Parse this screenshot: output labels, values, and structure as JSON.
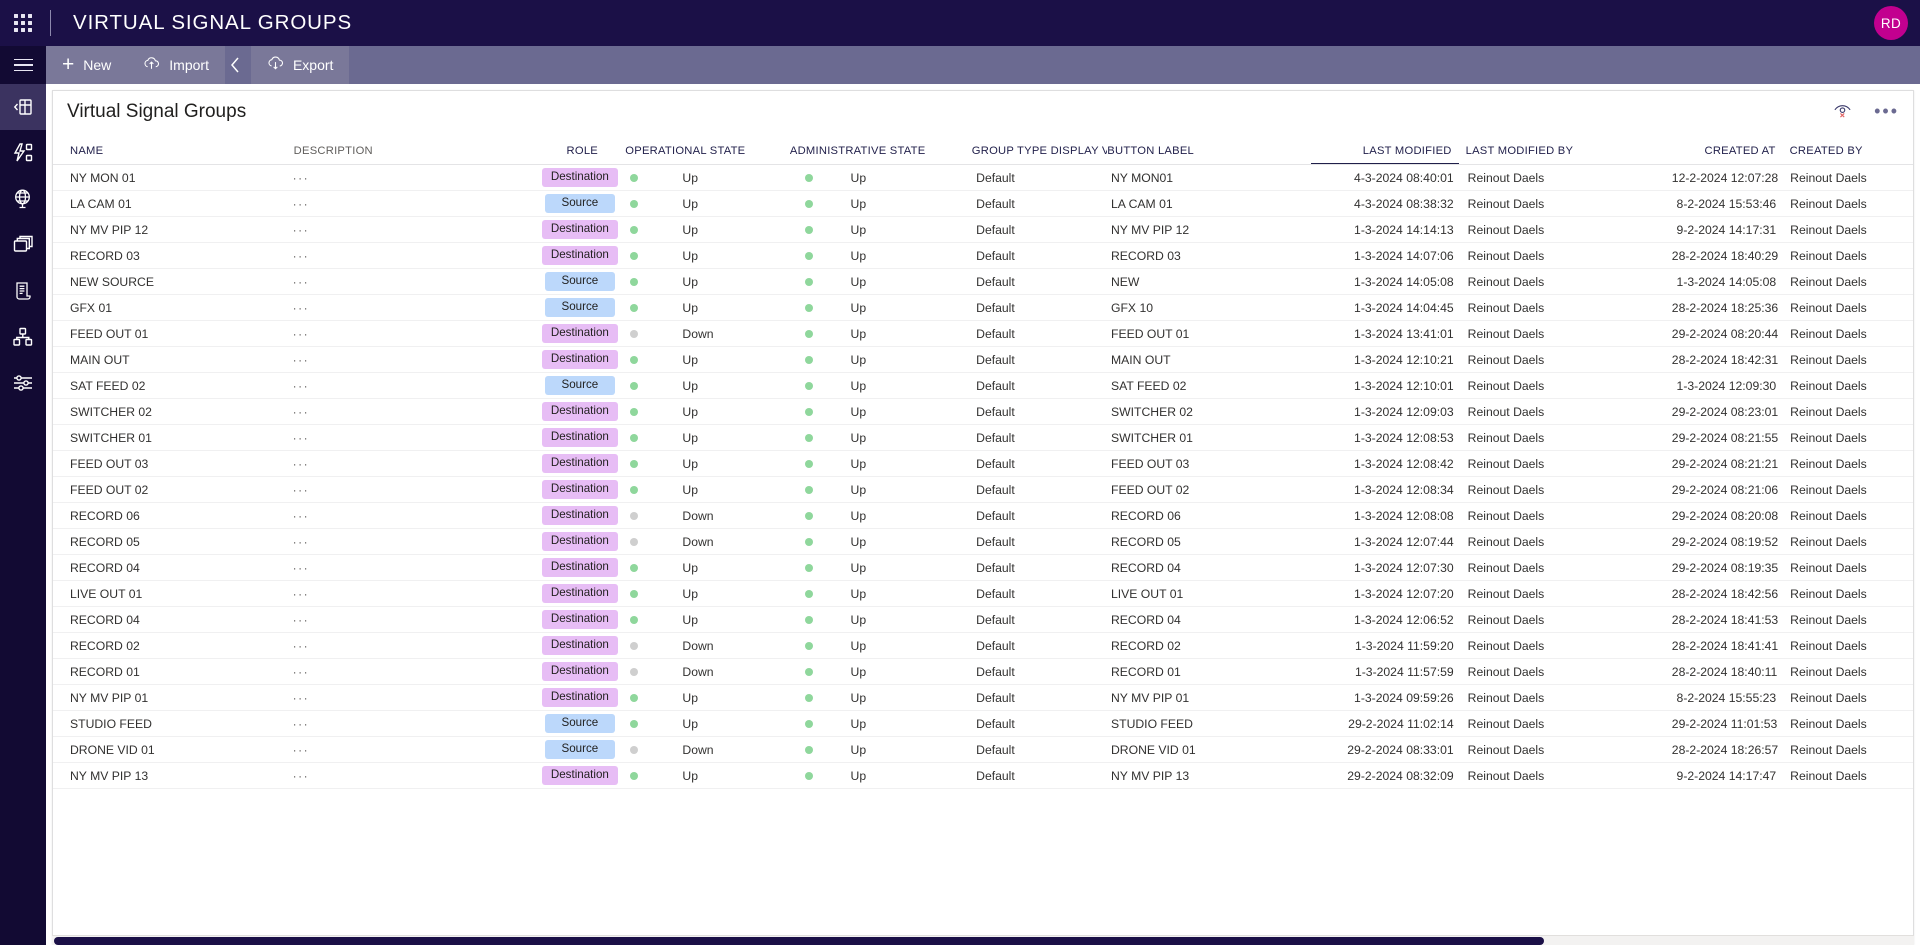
{
  "topbar": {
    "waffle_icon": "app-launcher-icon",
    "title": "VIRTUAL SIGNAL GROUPS",
    "avatar_initials": "RD",
    "avatar_color": "#c2008f",
    "background": "#1b1047"
  },
  "commandbar": {
    "background": "#6b6a91",
    "hamburger_icon": "hamburger-icon",
    "items": [
      {
        "label": "New",
        "icon": "plus-icon"
      },
      {
        "label": "Import",
        "icon": "cloud-upload-icon"
      },
      {
        "label": "Export",
        "icon": "cloud-download-icon"
      }
    ],
    "chevron_icon": "chevron-left-icon"
  },
  "rail": {
    "background": "#120a33",
    "items": [
      {
        "name": "collapse-panel-icon",
        "active": true
      },
      {
        "name": "signal-flow-icon",
        "active": false
      },
      {
        "name": "globe-network-icon",
        "active": false
      },
      {
        "name": "copy-layers-icon",
        "active": false
      },
      {
        "name": "script-document-icon",
        "active": false
      },
      {
        "name": "node-graph-icon",
        "active": false
      },
      {
        "name": "sliders-settings-icon",
        "active": false
      }
    ]
  },
  "panel": {
    "title": "Virtual Signal Groups",
    "hide_icon": "eye-hidden-icon",
    "more_icon": "more-options-icon"
  },
  "grid": {
    "sorted_column": "LAST MODIFIED",
    "sort_direction": "descending",
    "columns": [
      "NAME",
      "DESCRIPTION",
      "ROLE",
      "OPERATIONAL STATE",
      "ADMINISTRATIVE STATE",
      "GROUP TYPE DISPLAY VALUE",
      "BUTTON LABEL",
      "LAST MODIFIED",
      "LAST MODIFIED BY",
      "CREATED AT",
      "CREATED BY"
    ],
    "description_placeholder": "···",
    "rows": [
      {
        "name": "NY MON 01",
        "role": "Destination",
        "op": "Up",
        "admin": "Up",
        "group_type": "Default",
        "button_label": "NY MON01",
        "last_modified": "4-3-2024 08:40:01",
        "last_modified_by": "Reinout Daels",
        "created_at": "12-2-2024 12:07:28",
        "created_by": "Reinout Daels"
      },
      {
        "name": "LA CAM 01",
        "role": "Source",
        "op": "Up",
        "admin": "Up",
        "group_type": "Default",
        "button_label": "LA CAM 01",
        "last_modified": "4-3-2024 08:38:32",
        "last_modified_by": "Reinout Daels",
        "created_at": "8-2-2024 15:53:46",
        "created_by": "Reinout Daels"
      },
      {
        "name": "NY MV PIP 12",
        "role": "Destination",
        "op": "Up",
        "admin": "Up",
        "group_type": "Default",
        "button_label": "NY MV PIP 12",
        "last_modified": "1-3-2024 14:14:13",
        "last_modified_by": "Reinout Daels",
        "created_at": "9-2-2024 14:17:31",
        "created_by": "Reinout Daels"
      },
      {
        "name": "RECORD 03",
        "role": "Destination",
        "op": "Up",
        "admin": "Up",
        "group_type": "Default",
        "button_label": "RECORD 03",
        "last_modified": "1-3-2024 14:07:06",
        "last_modified_by": "Reinout Daels",
        "created_at": "28-2-2024 18:40:29",
        "created_by": "Reinout Daels"
      },
      {
        "name": "NEW SOURCE",
        "role": "Source",
        "op": "Up",
        "admin": "Up",
        "group_type": "Default",
        "button_label": "NEW",
        "last_modified": "1-3-2024 14:05:08",
        "last_modified_by": "Reinout Daels",
        "created_at": "1-3-2024 14:05:08",
        "created_by": "Reinout Daels"
      },
      {
        "name": "GFX 01",
        "role": "Source",
        "op": "Up",
        "admin": "Up",
        "group_type": "Default",
        "button_label": "GFX 10",
        "last_modified": "1-3-2024 14:04:45",
        "last_modified_by": "Reinout Daels",
        "created_at": "28-2-2024 18:25:36",
        "created_by": "Reinout Daels"
      },
      {
        "name": "FEED OUT 01",
        "role": "Destination",
        "op": "Down",
        "admin": "Up",
        "group_type": "Default",
        "button_label": "FEED OUT 01",
        "last_modified": "1-3-2024 13:41:01",
        "last_modified_by": "Reinout Daels",
        "created_at": "29-2-2024 08:20:44",
        "created_by": "Reinout Daels"
      },
      {
        "name": "MAIN OUT",
        "role": "Destination",
        "op": "Up",
        "admin": "Up",
        "group_type": "Default",
        "button_label": "MAIN OUT",
        "last_modified": "1-3-2024 12:10:21",
        "last_modified_by": "Reinout Daels",
        "created_at": "28-2-2024 18:42:31",
        "created_by": "Reinout Daels"
      },
      {
        "name": "SAT FEED 02",
        "role": "Source",
        "op": "Up",
        "admin": "Up",
        "group_type": "Default",
        "button_label": "SAT FEED 02",
        "last_modified": "1-3-2024 12:10:01",
        "last_modified_by": "Reinout Daels",
        "created_at": "1-3-2024 12:09:30",
        "created_by": "Reinout Daels"
      },
      {
        "name": "SWITCHER 02",
        "role": "Destination",
        "op": "Up",
        "admin": "Up",
        "group_type": "Default",
        "button_label": "SWITCHER 02",
        "last_modified": "1-3-2024 12:09:03",
        "last_modified_by": "Reinout Daels",
        "created_at": "29-2-2024 08:23:01",
        "created_by": "Reinout Daels"
      },
      {
        "name": "SWITCHER 01",
        "role": "Destination",
        "op": "Up",
        "admin": "Up",
        "group_type": "Default",
        "button_label": "SWITCHER 01",
        "last_modified": "1-3-2024 12:08:53",
        "last_modified_by": "Reinout Daels",
        "created_at": "29-2-2024 08:21:55",
        "created_by": "Reinout Daels"
      },
      {
        "name": "FEED OUT 03",
        "role": "Destination",
        "op": "Up",
        "admin": "Up",
        "group_type": "Default",
        "button_label": "FEED OUT 03",
        "last_modified": "1-3-2024 12:08:42",
        "last_modified_by": "Reinout Daels",
        "created_at": "29-2-2024 08:21:21",
        "created_by": "Reinout Daels"
      },
      {
        "name": "FEED OUT 02",
        "role": "Destination",
        "op": "Up",
        "admin": "Up",
        "group_type": "Default",
        "button_label": "FEED OUT 02",
        "last_modified": "1-3-2024 12:08:34",
        "last_modified_by": "Reinout Daels",
        "created_at": "29-2-2024 08:21:06",
        "created_by": "Reinout Daels"
      },
      {
        "name": "RECORD 06",
        "role": "Destination",
        "op": "Down",
        "admin": "Up",
        "group_type": "Default",
        "button_label": "RECORD 06",
        "last_modified": "1-3-2024 12:08:08",
        "last_modified_by": "Reinout Daels",
        "created_at": "29-2-2024 08:20:08",
        "created_by": "Reinout Daels"
      },
      {
        "name": "RECORD 05",
        "role": "Destination",
        "op": "Down",
        "admin": "Up",
        "group_type": "Default",
        "button_label": "RECORD 05",
        "last_modified": "1-3-2024 12:07:44",
        "last_modified_by": "Reinout Daels",
        "created_at": "29-2-2024 08:19:52",
        "created_by": "Reinout Daels"
      },
      {
        "name": "RECORD 04",
        "role": "Destination",
        "op": "Up",
        "admin": "Up",
        "group_type": "Default",
        "button_label": "RECORD 04",
        "last_modified": "1-3-2024 12:07:30",
        "last_modified_by": "Reinout Daels",
        "created_at": "29-2-2024 08:19:35",
        "created_by": "Reinout Daels"
      },
      {
        "name": "LIVE OUT 01",
        "role": "Destination",
        "op": "Up",
        "admin": "Up",
        "group_type": "Default",
        "button_label": "LIVE OUT 01",
        "last_modified": "1-3-2024 12:07:20",
        "last_modified_by": "Reinout Daels",
        "created_at": "28-2-2024 18:42:56",
        "created_by": "Reinout Daels"
      },
      {
        "name": "RECORD 04",
        "role": "Destination",
        "op": "Up",
        "admin": "Up",
        "group_type": "Default",
        "button_label": "RECORD 04",
        "last_modified": "1-3-2024 12:06:52",
        "last_modified_by": "Reinout Daels",
        "created_at": "28-2-2024 18:41:53",
        "created_by": "Reinout Daels"
      },
      {
        "name": "RECORD 02",
        "role": "Destination",
        "op": "Down",
        "admin": "Up",
        "group_type": "Default",
        "button_label": "RECORD 02",
        "last_modified": "1-3-2024 11:59:20",
        "last_modified_by": "Reinout Daels",
        "created_at": "28-2-2024 18:41:41",
        "created_by": "Reinout Daels"
      },
      {
        "name": "RECORD 01",
        "role": "Destination",
        "op": "Down",
        "admin": "Up",
        "group_type": "Default",
        "button_label": "RECORD 01",
        "last_modified": "1-3-2024 11:57:59",
        "last_modified_by": "Reinout Daels",
        "created_at": "28-2-2024 18:40:11",
        "created_by": "Reinout Daels"
      },
      {
        "name": "NY MV PIP 01",
        "role": "Destination",
        "op": "Up",
        "admin": "Up",
        "group_type": "Default",
        "button_label": "NY MV PIP 01",
        "last_modified": "1-3-2024 09:59:26",
        "last_modified_by": "Reinout Daels",
        "created_at": "8-2-2024 15:55:23",
        "created_by": "Reinout Daels"
      },
      {
        "name": "STUDIO FEED",
        "role": "Source",
        "op": "Up",
        "admin": "Up",
        "group_type": "Default",
        "button_label": "STUDIO FEED",
        "last_modified": "29-2-2024 11:02:14",
        "last_modified_by": "Reinout Daels",
        "created_at": "29-2-2024 11:01:53",
        "created_by": "Reinout Daels"
      },
      {
        "name": "DRONE VID 01",
        "role": "Source",
        "op": "Down",
        "admin": "Up",
        "group_type": "Default",
        "button_label": "DRONE VID 01",
        "last_modified": "29-2-2024 08:33:01",
        "last_modified_by": "Reinout Daels",
        "created_at": "28-2-2024 18:26:57",
        "created_by": "Reinout Daels"
      },
      {
        "name": "NY MV PIP 13",
        "role": "Destination",
        "op": "Up",
        "admin": "Up",
        "group_type": "Default",
        "button_label": "NY MV PIP 13",
        "last_modified": "29-2-2024 08:32:09",
        "last_modified_by": "Reinout Daels",
        "created_at": "9-2-2024 14:17:47",
        "created_by": "Reinout Daels"
      }
    ]
  },
  "colors": {
    "destination_pill": "#e7bdf5",
    "source_pill": "#bcd8fb",
    "state_up_dot": "#8fd79c",
    "state_down_dot": "#cfcfcf",
    "brand_dark": "#1b1047",
    "command_bar": "#6b6a91"
  }
}
